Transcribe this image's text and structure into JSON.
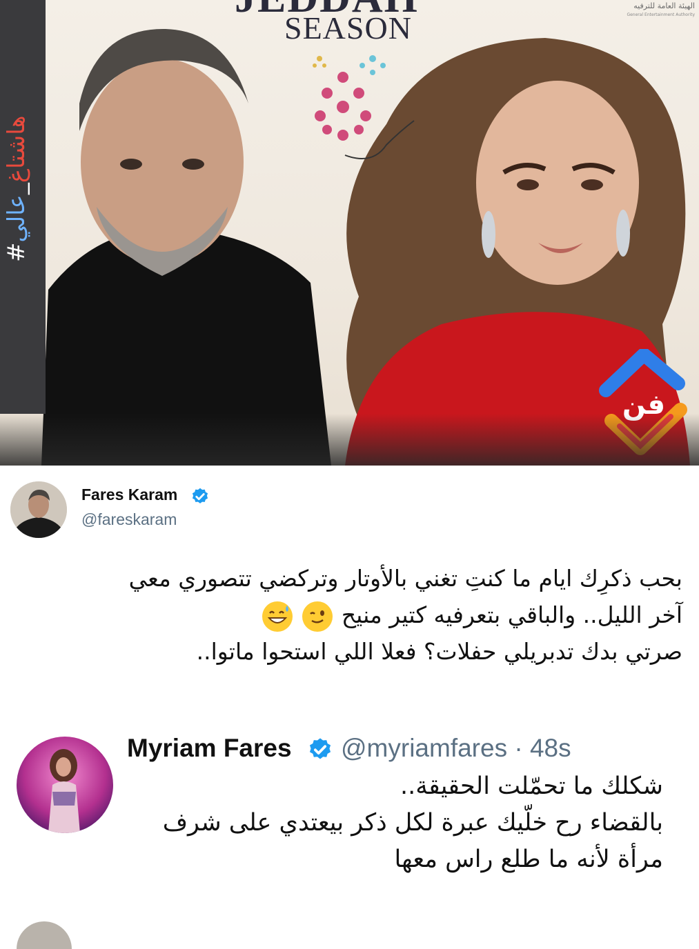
{
  "poster": {
    "title_top": "JEDDAH",
    "season": "SEASON",
    "authority_ar": "الهيئة العامة للترفيه",
    "authority_en": "General Entertainment Authority",
    "side_tag_hash": "#",
    "side_tag_red": "هاشتاغ",
    "side_tag_sep": "_",
    "side_tag_blue": "عالي",
    "watermark_text": "فن",
    "colors": {
      "accent_blue": "#1d9bf0",
      "logo_orange": "#f59a1d",
      "logo_red": "#e53b3a",
      "logo_blue": "#2f7ee8"
    }
  },
  "tweet1": {
    "name": "Fares Karam",
    "handle": "@fareskaram",
    "verified_icon": "verified-badge-icon",
    "line1": "بحب ذكرِك ايام ما كنتِ تغني بالأوتار وتركضي تتصوري معي",
    "line2": "آخر الليل.. والباقي بتعرفيه كتير منيح",
    "line3": "صرتي بدك تدبريلي حفلات؟ فعلا اللي استحوا ماتوا..",
    "emojis": [
      "winking-face-icon",
      "grinning-sweat-face-icon"
    ]
  },
  "tweet2": {
    "name": "Myriam Fares",
    "handle": "@myriamfares · 48s",
    "verified_icon": "verified-badge-icon",
    "line1": "شكلك ما تحمّلت الحقيقة..",
    "line2": "بالقضاء رح خلّيك عبرة لكل ذكر بيعتدي على شرف",
    "line3": "مرأة لأنه ما طلع راس معها"
  }
}
